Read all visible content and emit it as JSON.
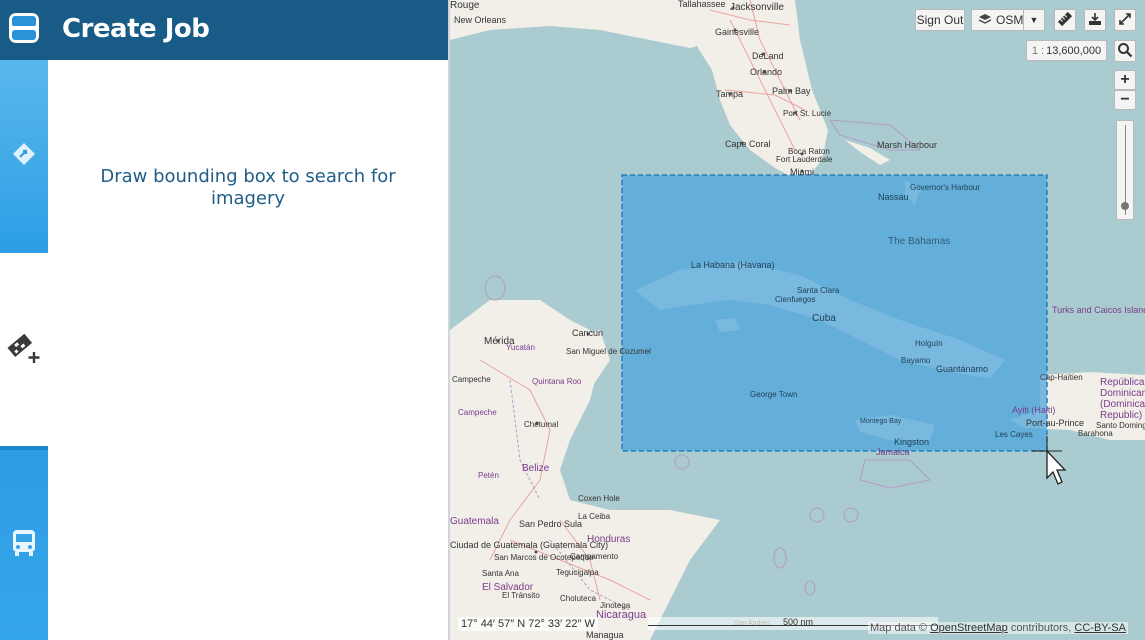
{
  "app": {
    "title": "Create Job",
    "instruction": "Draw bounding box to search for imagery"
  },
  "sidebar": {
    "items": [
      {
        "name": "logo",
        "icon": "app-logo-icon"
      },
      {
        "name": "search-imagery",
        "icon": "diamond-arrow-icon"
      },
      {
        "name": "create-job",
        "icon": "job-add-icon",
        "active": true
      },
      {
        "name": "transit",
        "icon": "bus-icon"
      }
    ]
  },
  "map_controls": {
    "sign_out": "Sign Out",
    "basemap": "OSM",
    "scale_prefix": "1 :",
    "scale": "13,600,000",
    "zoom_in": "+",
    "zoom_out": "−",
    "zoom_level": 0.9
  },
  "map_footer": {
    "coordinates": "17° 44′ 57″ N 72° 33′ 22″ W",
    "scale_label": "500 nm",
    "attribution_prefix": "Map data ©",
    "attribution_link": "OpenStreetMap",
    "attribution_suffix": "contributors,",
    "attribution_license": "CC-BY-SA"
  },
  "map_labels": [
    "Rouge",
    "New Orleans",
    "Tallahassee",
    "Jacksonville",
    "Gainesville",
    "DeLand",
    "Orlando",
    "Tampa",
    "Palm Bay",
    "Port St. Lucie",
    "Cape Coral",
    "Boca Raton",
    "Fort Lauderdale",
    "Miami",
    "Marsh Harbour",
    "Nassau",
    "Governor's Harbour",
    "The Bahamas",
    "La Habana (Havana)",
    "Cuba",
    "Santa Clara",
    "Cienfuegos",
    "Holguín",
    "Bayamo",
    "Guantánamo",
    "Mérida",
    "Cancun",
    "San Miguel de Cozumel",
    "Campeche",
    "Chetumal",
    "Belize",
    "George Town",
    "Montego Bay",
    "Kingston",
    "Jamaica",
    "Turks and Caicos Islands",
    "Cap-Haïtien",
    "Ayiti (Haiti)",
    "Port-au-Prince",
    "Les Cayes",
    "República Dominicana (Dominican Republic)",
    "Santo Domingo",
    "Barahona",
    "Honduras",
    "Coxen Hole",
    "La Ceiba",
    "San Pedro Sula",
    "Guatemala",
    "Ciudad de Guatemala (Guatemala City)",
    "San Marcos de Ocotepeque",
    "Campamento",
    "Tegucigalpa",
    "Santa Ana",
    "El Salvador",
    "El Tránsito",
    "Choluteca",
    "Jinotega",
    "Nicaragua",
    "Managua",
    "San Andrés",
    "Quintana Roo",
    "Yucatán",
    "Petén",
    "Campeche"
  ]
}
